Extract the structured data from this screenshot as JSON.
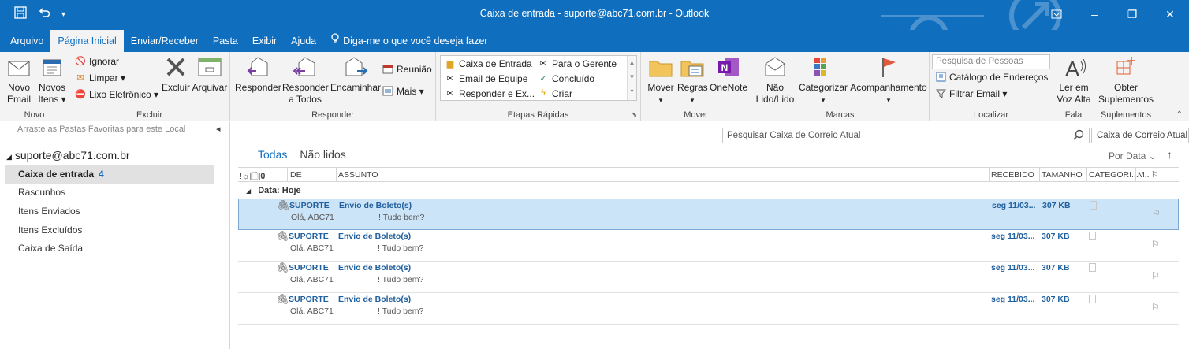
{
  "window": {
    "title": "Caixa de entrada - suporte@abc71.com.br  -  Outlook",
    "qat": {
      "save_icon": "save-icon",
      "undo_icon": "undo-icon",
      "customize_icon": "qat-dropdown-icon"
    },
    "controls": {
      "restore_ribbon": "ribbon-display-icon",
      "minimize": "–",
      "maximize": "❐",
      "close": "✕"
    }
  },
  "tabs": [
    {
      "label": "Arquivo"
    },
    {
      "label": "Página Inicial"
    },
    {
      "label": "Enviar/Receber"
    },
    {
      "label": "Pasta"
    },
    {
      "label": "Exibir"
    },
    {
      "label": "Ajuda"
    },
    {
      "label": "Diga-me o que você deseja fazer"
    }
  ],
  "ribbon": {
    "novo": {
      "group": "Novo",
      "novo_email_1": "Novo",
      "novo_email_2": "Email",
      "novos_itens_1": "Novos",
      "novos_itens_2": "Itens ▾"
    },
    "excluir": {
      "group": "Excluir",
      "ignorar": "Ignorar",
      "limpar": "Limpar ▾",
      "lixo": "Lixo Eletrônico ▾",
      "excluir": "Excluir",
      "arquivar": "Arquivar"
    },
    "responder": {
      "group": "Responder",
      "responder": "Responder",
      "responder_todos_1": "Responder",
      "responder_todos_2": "a Todos",
      "encaminhar": "Encaminhar",
      "reuniao": "Reunião",
      "mais": "Mais ▾"
    },
    "etapas": {
      "group": "Etapas Rápidas",
      "caixa_entrada": "Caixa de Entrada",
      "email_equipe": "Email de Equipe",
      "responder_ex": "Responder e Ex...",
      "para_gerente": "Para o Gerente",
      "concluido": "Concluído",
      "criar": "Criar"
    },
    "mover": {
      "group": "Mover",
      "mover": "Mover",
      "regras": "Regras",
      "onenote": "OneNote"
    },
    "marcas": {
      "group": "Marcas",
      "nao_lido_1": "Não",
      "nao_lido_2": "Lido/Lido",
      "categorizar": "Categorizar",
      "acompanhamento": "Acompanhamento"
    },
    "localizar": {
      "group": "Localizar",
      "pesquisa_pessoas": "Pesquisa de Pessoas",
      "catalogo": "Catálogo de Endereços",
      "filtrar": "Filtrar Email ▾"
    },
    "fala": {
      "group": "Fala",
      "ler_1": "Ler em",
      "ler_2": "Voz Alta"
    },
    "suplementos": {
      "group": "Suplementos",
      "obter_1": "Obter",
      "obter_2": "Suplementos"
    }
  },
  "sidebar": {
    "favorites_hint": "Arraste as Pastas Favoritas para este Local",
    "collapse": "◂",
    "account": "suporte@abc71.com.br",
    "folders": [
      {
        "label": "Caixa de entrada",
        "count": "4"
      },
      {
        "label": "Rascunhos"
      },
      {
        "label": "Itens Enviados"
      },
      {
        "label": "Itens Excluídos"
      },
      {
        "label": "Caixa de Saída"
      }
    ]
  },
  "search": {
    "placeholder": "Pesquisar Caixa de Correio Atual",
    "scope": "Caixa de Correio Atual"
  },
  "list": {
    "filters": {
      "all": "Todas",
      "unread": "Não lidos"
    },
    "sort": "Por Data ⌄",
    "sort_dir": "↑",
    "columns": {
      "icons": "!☼|🗋|𝟎",
      "from": "DE",
      "subject": "ASSUNTO",
      "received": "RECEBIDO",
      "size": "TAMANHO",
      "categories": "CATEGORI...",
      "mention": "M..",
      "flag": "⚐"
    },
    "group": "Data: Hoje",
    "messages": [
      {
        "from": "SUPORTE",
        "subject": "Envio de Boleto(s)",
        "received": "seg 11/03...",
        "size": "307 KB",
        "preview1": "Olá, ABC71",
        "preview2": "! Tudo bem?"
      },
      {
        "from": "SUPORTE",
        "subject": "Envio de Boleto(s)",
        "received": "seg 11/03...",
        "size": "307 KB",
        "preview1": "Olá, ABC71",
        "preview2": "! Tudo bem?"
      },
      {
        "from": "SUPORTE",
        "subject": "Envio de Boleto(s)",
        "received": "seg 11/03...",
        "size": "307 KB",
        "preview1": "Olá, ABC71",
        "preview2": "! Tudo bem?"
      },
      {
        "from": "SUPORTE",
        "subject": "Envio de Boleto(s)",
        "received": "seg 11/03...",
        "size": "307 KB",
        "preview1": "Olá, ABC71",
        "preview2": "! Tudo bem?"
      }
    ]
  },
  "colors": {
    "accent": "#106ebe",
    "selected_row": "#cce4f7",
    "ribbon_bg": "#f3f3f3"
  }
}
